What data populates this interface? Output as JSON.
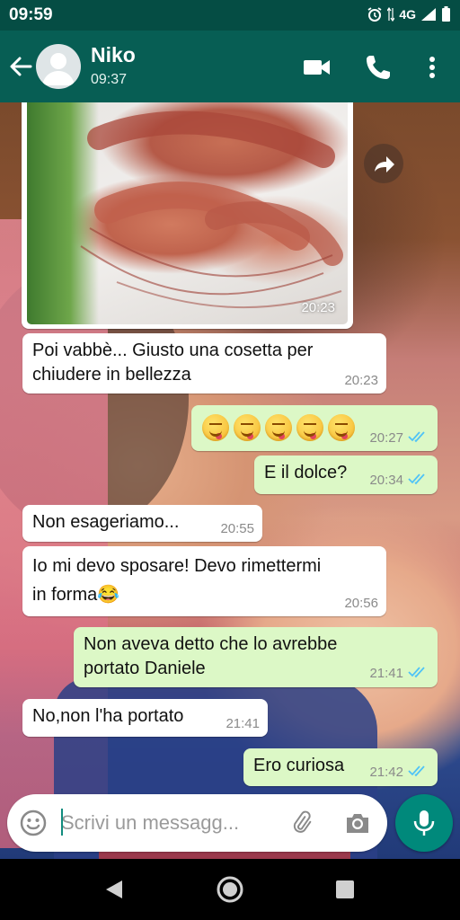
{
  "status_bar": {
    "time": "09:59",
    "network": "4G"
  },
  "header": {
    "contact_name": "Niko",
    "subtitle": "09:37"
  },
  "photo_message": {
    "time": "20:23"
  },
  "messages": [
    {
      "direction": "in",
      "text_lines": [
        "Poi vabbè... Giusto una cosetta per",
        "chiudere in bellezza"
      ],
      "time": "20:23"
    },
    {
      "direction": "out",
      "emoji": [
        "face-savoring-food",
        "face-savoring-food",
        "face-savoring-food",
        "face-savoring-food",
        "face-savoring-food"
      ],
      "time": "20:27",
      "status": "read"
    },
    {
      "direction": "out",
      "text": "E il dolce?",
      "time": "20:34",
      "status": "read"
    },
    {
      "direction": "in",
      "text": "Non esageriamo...",
      "time": "20:55"
    },
    {
      "direction": "in",
      "text_lines": [
        "Io mi devo sposare! Devo rimettermi",
        "in forma😂"
      ],
      "time": "20:56"
    },
    {
      "direction": "out",
      "text_lines": [
        "Non aveva detto che lo avrebbe",
        "portato Daniele"
      ],
      "time": "21:41",
      "status": "read"
    },
    {
      "direction": "in",
      "text": "No,non l'ha portato",
      "time": "21:41"
    },
    {
      "direction": "out",
      "text": "Ero curiosa",
      "time": "21:42",
      "status": "read"
    }
  ],
  "composer": {
    "placeholder": "Scrivi un messagg..."
  },
  "colors": {
    "header": "#075e54",
    "status_bar": "#054d44",
    "outgoing_bubble": "#dcf8c6",
    "incoming_bubble": "#ffffff",
    "read_ticks": "#4fc3f7",
    "mic_button": "#00897b"
  }
}
